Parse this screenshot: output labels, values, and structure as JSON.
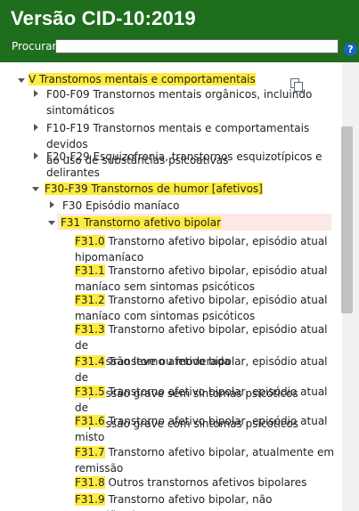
{
  "header": {
    "title": "Versão CID-10:2019",
    "search_label": "Procurar",
    "search_value": "",
    "help_icon": "?"
  },
  "tree": {
    "chapter": "V Transtornos mentais e comportamentais",
    "groups": [
      {
        "label_line1": "F00-F09 Transtornos mentais orgânicos, incluindo",
        "label_line2": "sintomáticos"
      },
      {
        "label_line1": "F10-F19 Transtornos mentais e comportamentais devidos",
        "label_line2": "ao uso de substâncias psicoativas"
      },
      {
        "label_line1": "F20-F29 Esquizofrenia, transtornos esquizotípicos e",
        "label_line2": "delirantes"
      }
    ],
    "open_group": "F30-F39 Transtornos de humor [afetivos]",
    "f30": "F30 Episódio maníaco",
    "f31": "F31 Transtorno afetivo bipolar",
    "codes": [
      {
        "code": "F31.0",
        "line1": "Transtorno afetivo bipolar, episódio atual",
        "line2": "hipomaníaco"
      },
      {
        "code": "F31.1",
        "line1": "Transtorno afetivo bipolar, episódio atual",
        "line2": "maníaco sem sintomas psicóticos"
      },
      {
        "code": "F31.2",
        "line1": "Transtorno afetivo bipolar, episódio atual",
        "line2": "maníaco com sintomas psicóticos"
      },
      {
        "code": "F31.3",
        "line1": "Transtorno afetivo bipolar, episódio atual de",
        "line2": "depressão leve ou moderada"
      },
      {
        "code": "F31.4",
        "line1": "Transtorno afetivo bipolar, episódio atual de",
        "line2": "depressão grave sem sintomas psicóticos"
      },
      {
        "code": "F31.5",
        "line1": "Transtorno afetivo bipolar, episódio atual de",
        "line2": "depressão grave com sintomas psicóticos"
      },
      {
        "code": "F31.6",
        "line1": "Transtorno afetivo bipolar, episódio atual",
        "line2": "misto"
      },
      {
        "code": "F31.7",
        "line1": "Transtorno afetivo bipolar, atualmente em",
        "line2": "remissão"
      },
      {
        "code": "F31.8",
        "line1": "Outros transtornos afetivos bipolares",
        "line2": ""
      },
      {
        "code": "F31.9",
        "line1": "Transtorno afetivo bipolar, não especificado",
        "line2": ""
      }
    ]
  },
  "colors": {
    "header_bg": "#1e6e1e",
    "highlight": "#ffeb3b",
    "selected_bg": "#fbe9e7",
    "help": "#1565c0"
  }
}
